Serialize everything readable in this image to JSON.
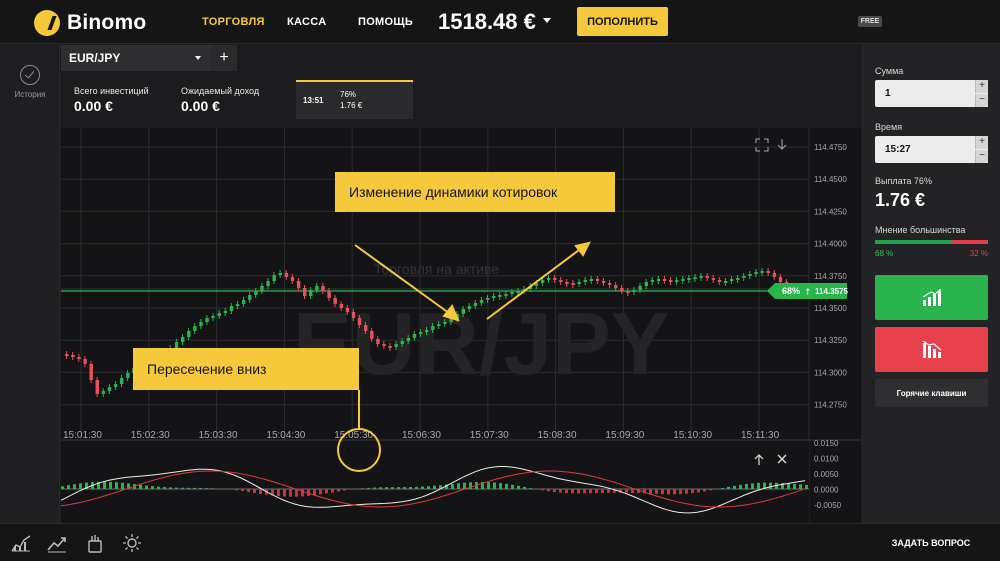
{
  "header": {
    "logo_text": "Binomo",
    "nav": [
      {
        "label": "ТОРГОВЛЯ",
        "active": true
      },
      {
        "label": "КАССА",
        "active": false
      },
      {
        "label": "ПОМОЩЬ",
        "active": false
      }
    ],
    "balance": "1518.48 €",
    "deposit_label": "ПОПОЛНИТЬ",
    "free_badge": "FREE"
  },
  "sidebar": {
    "history_label": "История"
  },
  "asset": {
    "name": "EUR/JPY",
    "add_label": "+"
  },
  "investments": {
    "total_label": "Всего инвестиций",
    "total_value": "0.00 €",
    "expected_label": "Ожидаемый доход",
    "expected_value": "0.00 €"
  },
  "deal_card": {
    "time": "13:51",
    "percent": "76%",
    "amount": "1.76 €"
  },
  "chart": {
    "watermark": "EUR/JPY",
    "watermark_sub": "Торговля на активе",
    "current_price": "114.3575",
    "current_percent": "68%",
    "y_ticks": [
      "114.4750",
      "114.4500",
      "114.4250",
      "114.4000",
      "114.3750",
      "114.3500",
      "114.3250",
      "114.3000",
      "114.2750"
    ],
    "x_ticks": [
      "15:01:30",
      "15:02:30",
      "15:03:30",
      "15:04:30",
      "15:05:30",
      "15:06:30",
      "15:07:30",
      "15:08:30",
      "15:09:30",
      "15:10:30",
      "15:11:30"
    ],
    "ind_ticks": [
      "0.0150",
      "0.0100",
      "0.0050",
      "0.0000",
      "-0.0050"
    ]
  },
  "annotations": {
    "top": "Изменение динамики котировок",
    "bottom": "Пересечение вниз"
  },
  "right_panel": {
    "amount_label": "Сумма",
    "amount_value": "1",
    "time_label": "Время",
    "time_value": "15:27",
    "payout_label": "Выплата 76%",
    "payout_value": "1.76 €",
    "majority_label": "Мнение большинства",
    "majority_up": "68 %",
    "majority_down": "32 %",
    "majority_up_fraction": 0.68,
    "hotkeys_label": "Горячие клавиши"
  },
  "footer": {
    "ask_label": "ЗАДАТЬ ВОПРОС"
  },
  "colors": {
    "accent": "#f6c83c",
    "up": "#2ab44d",
    "down": "#e8414e"
  },
  "icons": [
    "history-icon",
    "fullscreen-icon",
    "download-icon",
    "arrow-up-icon",
    "close-icon",
    "chart-up-icon",
    "chart-down-icon",
    "chart-type-icon",
    "trend-icon",
    "tools-icon",
    "brightness-icon"
  ]
}
